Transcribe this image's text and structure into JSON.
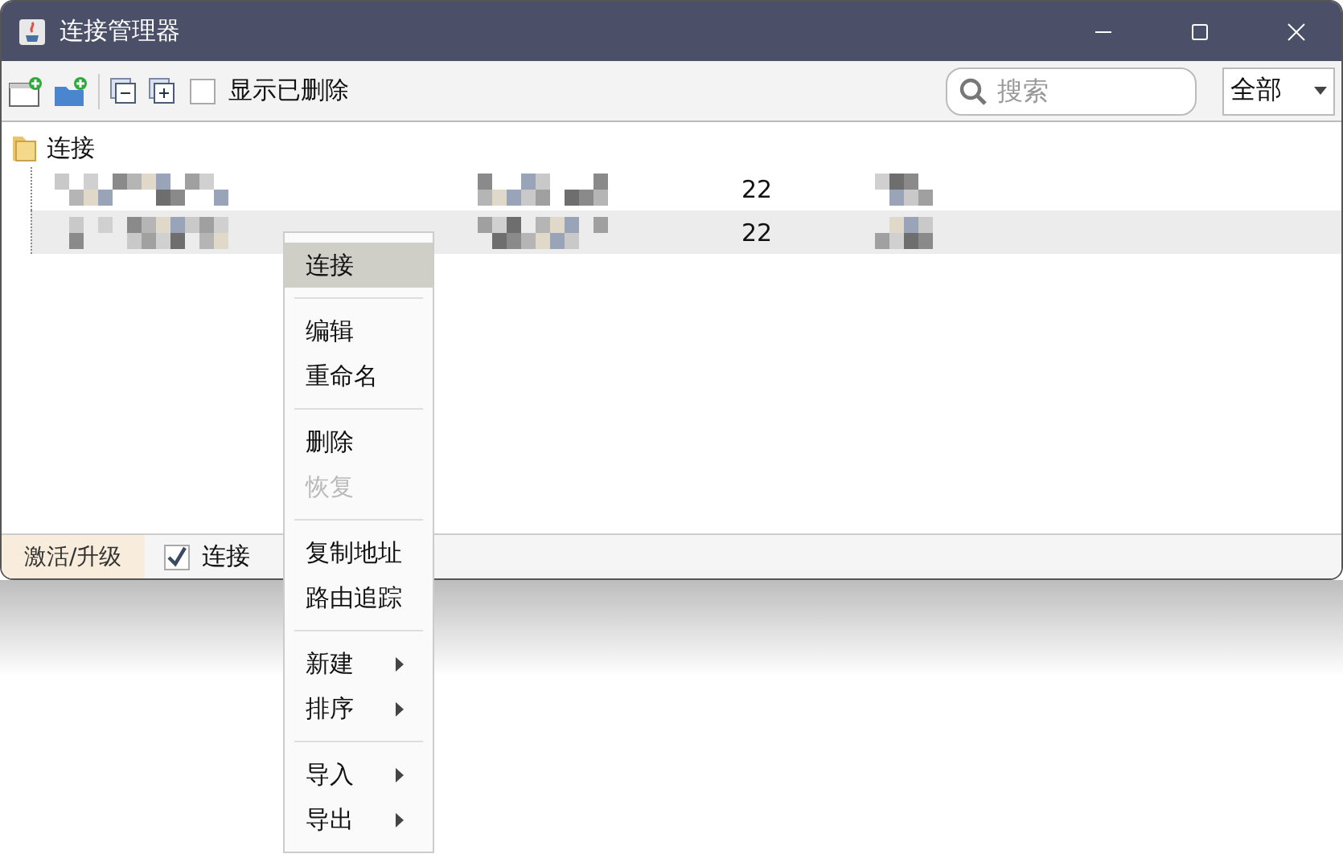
{
  "window": {
    "title": "连接管理器"
  },
  "toolbar": {
    "show_deleted": {
      "label": "显示已删除",
      "checked": false
    },
    "search": {
      "placeholder": "搜索"
    },
    "filter": {
      "value": "全部"
    }
  },
  "tree": {
    "root": {
      "label": "连接",
      "expanded": true
    },
    "rows": [
      {
        "port": "22",
        "selected": false
      },
      {
        "port": "22",
        "selected": true
      }
    ]
  },
  "status_bar": {
    "activate_button": "激活/升级",
    "auto_checkbox": {
      "label": "连接",
      "checked": true
    }
  },
  "context_menu": [
    {
      "kind": "item",
      "label": "连接",
      "selected": true,
      "disabled": false,
      "submenu": false
    },
    {
      "kind": "separator"
    },
    {
      "kind": "item",
      "label": "编辑",
      "selected": false,
      "disabled": false,
      "submenu": false
    },
    {
      "kind": "item",
      "label": "重命名",
      "selected": false,
      "disabled": false,
      "submenu": false
    },
    {
      "kind": "separator"
    },
    {
      "kind": "item",
      "label": "删除",
      "selected": false,
      "disabled": false,
      "submenu": false
    },
    {
      "kind": "item",
      "label": "恢复",
      "selected": false,
      "disabled": true,
      "submenu": false
    },
    {
      "kind": "separator"
    },
    {
      "kind": "item",
      "label": "复制地址",
      "selected": false,
      "disabled": false,
      "submenu": false
    },
    {
      "kind": "item",
      "label": "路由追踪",
      "selected": false,
      "disabled": false,
      "submenu": false
    },
    {
      "kind": "separator"
    },
    {
      "kind": "item",
      "label": "新建",
      "selected": false,
      "disabled": false,
      "submenu": true
    },
    {
      "kind": "item",
      "label": "排序",
      "selected": false,
      "disabled": false,
      "submenu": true
    },
    {
      "kind": "separator"
    },
    {
      "kind": "item",
      "label": "导入",
      "selected": false,
      "disabled": false,
      "submenu": true
    },
    {
      "kind": "item",
      "label": "导出",
      "selected": false,
      "disabled": false,
      "submenu": true
    }
  ]
}
